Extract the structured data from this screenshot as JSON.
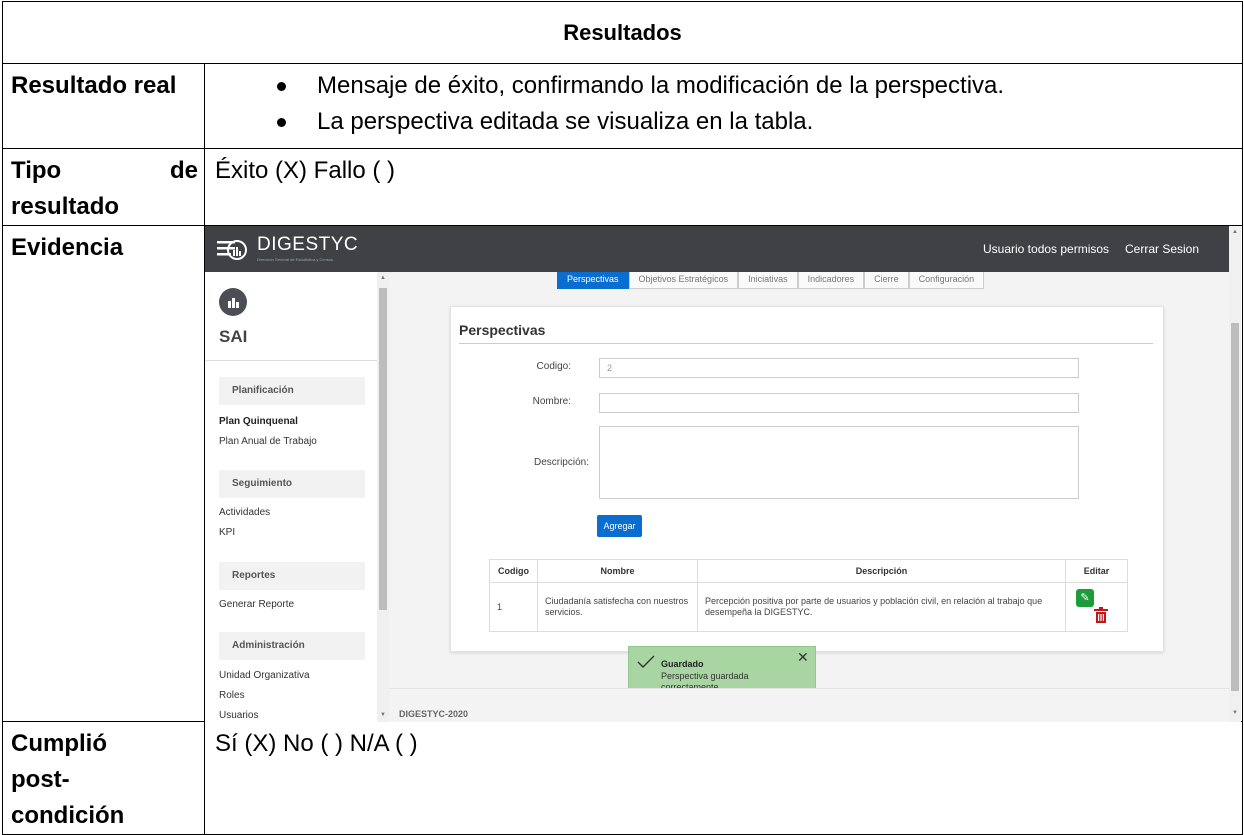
{
  "doc": {
    "header": "Resultados",
    "rows": [
      {
        "label": "Resultado real",
        "bullets": [
          "Mensaje de éxito, confirmando la modificación de la perspectiva.",
          "La perspectiva editada se visualiza en la tabla."
        ]
      },
      {
        "label_a": "Tipo",
        "label_b": "de",
        "label_c": "resultado",
        "value": "Éxito (X) Fallo ( )"
      },
      {
        "label": "Evidencia"
      },
      {
        "label_a": "Cumplió",
        "label_b": "post-",
        "label_c": "condición",
        "value": "Sí (X) No ( )  N/A ( )"
      }
    ]
  },
  "shot": {
    "brand": "DIGESTYC",
    "brand_sub": "Dirección General de Estadística y Censos",
    "user": "Usuario todos permisos",
    "logout": "Cerrar Sesion",
    "app_name": "SAI",
    "sidebar": {
      "sections": [
        {
          "title": "Planificación",
          "items": [
            "Plan Quinquenal",
            "Plan Anual de Trabajo"
          ]
        },
        {
          "title": "Seguimiento",
          "items": [
            "Actividades",
            "KPI"
          ]
        },
        {
          "title": "Reportes",
          "items": [
            "Generar Reporte"
          ]
        },
        {
          "title": "Administración",
          "items": [
            "Unidad Organizativa",
            "Roles",
            "Usuarios"
          ]
        }
      ]
    },
    "tabs": [
      "Perspectivas",
      "Objetivos Estratégicos",
      "Iniciativas",
      "Indicadores",
      "Cierre",
      "Configuración"
    ],
    "form": {
      "title": "Perspectivas",
      "codigo_label": "Codigo:",
      "codigo_value": "2",
      "nombre_label": "Nombre:",
      "descripcion_label": "Descripción:",
      "add_button": "Agregar"
    },
    "table": {
      "headers": [
        "Codigo",
        "Nombre",
        "Descripción",
        "Editar"
      ],
      "rows": [
        {
          "codigo": "1",
          "nombre": "Ciudadanía satisfecha con nuestros servicios.",
          "descripcion": "Percepción positiva por parte de usuarios y población civil, en relación al trabajo que desempeña la DIGESTYC."
        }
      ]
    },
    "toast": {
      "title": "Guardado",
      "message": "Perspectiva guardada correctamente"
    },
    "footer": "DIGESTYC-2020",
    "colors": {
      "topbar": "#3f4144",
      "primary": "#0a6ed1",
      "toast": "#a8d5a2",
      "edit": "#1e9b3a",
      "delete": "#c0181a"
    }
  }
}
